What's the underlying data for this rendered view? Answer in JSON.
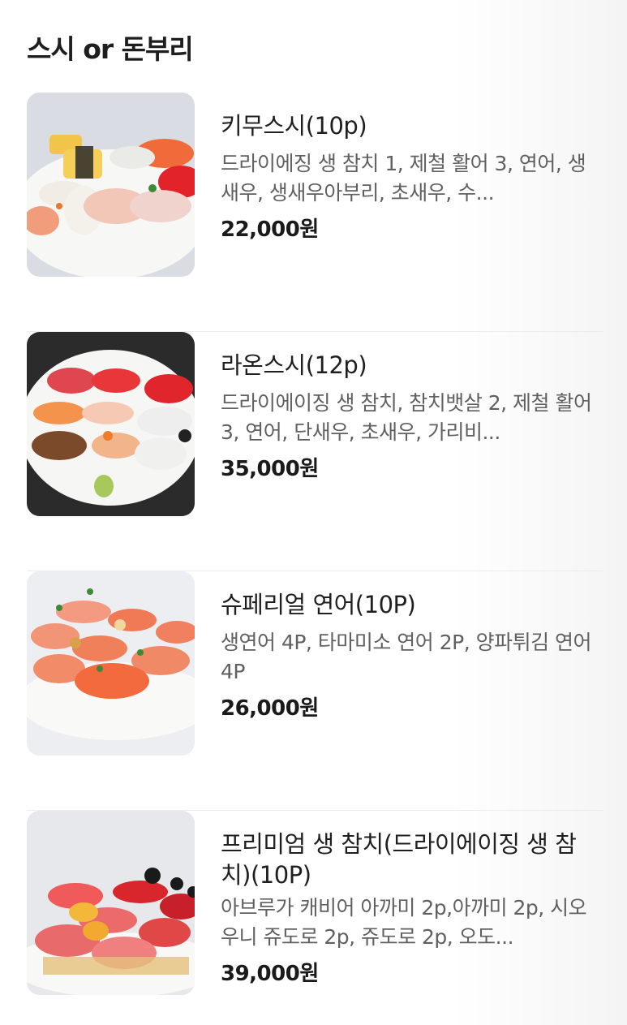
{
  "section": {
    "title": "스시 or 돈부리"
  },
  "menu": {
    "items": [
      {
        "name": "키무스시(10p)",
        "description": "드라이에징 생 참치 1, 제철 활어 3, 연어, 생새우, 생새우아부리, 초새우, 수...",
        "price": "22,000원",
        "image": "sushi-platter-image"
      },
      {
        "name": "라온스시(12p)",
        "description": "드라이에이징 생 참치, 참치뱃살 2, 제철 활어 3, 연어, 단새우, 초새우, 가리비...",
        "price": "35,000원",
        "image": "sushi-platter-image"
      },
      {
        "name": "슈페리얼 연어(10P)",
        "description": "생연어 4P, 타마미소 연어 2P, 양파튀김 연어 4P",
        "price": "26,000원",
        "image": "salmon-sushi-image"
      },
      {
        "name": "프리미엄 생 참치(드라이에이징 생 참치)(10P)",
        "description": "아브루가 캐비어 아까미 2p,아까미 2p, 시오우니 쥬도로 2p, 쥬도로 2p, 오도...",
        "price": "39,000원",
        "image": "tuna-sushi-image"
      }
    ]
  },
  "colors": {
    "price": "#1a1a1a",
    "description": "#606060",
    "divider": "#ececec"
  }
}
